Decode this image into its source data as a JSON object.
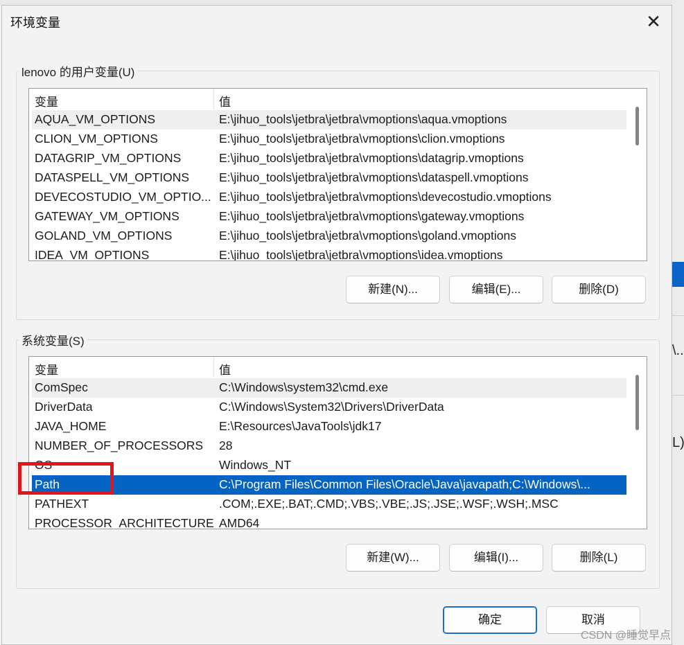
{
  "window": {
    "title": "环境变量",
    "close_label": "✕"
  },
  "user_vars": {
    "group_label": "lenovo 的用户变量(U)",
    "col_name": "变量",
    "col_value": "值",
    "rows": [
      {
        "name": "AQUA_VM_OPTIONS",
        "value": "E:\\jihuo_tools\\jetbra\\jetbra\\vmoptions\\aqua.vmoptions"
      },
      {
        "name": "CLION_VM_OPTIONS",
        "value": "E:\\jihuo_tools\\jetbra\\jetbra\\vmoptions\\clion.vmoptions"
      },
      {
        "name": "DATAGRIP_VM_OPTIONS",
        "value": "E:\\jihuo_tools\\jetbra\\jetbra\\vmoptions\\datagrip.vmoptions"
      },
      {
        "name": "DATASPELL_VM_OPTIONS",
        "value": "E:\\jihuo_tools\\jetbra\\jetbra\\vmoptions\\dataspell.vmoptions"
      },
      {
        "name": "DEVECOSTUDIO_VM_OPTIO...",
        "value": "E:\\jihuo_tools\\jetbra\\jetbra\\vmoptions\\devecostudio.vmoptions"
      },
      {
        "name": "GATEWAY_VM_OPTIONS",
        "value": "E:\\jihuo_tools\\jetbra\\jetbra\\vmoptions\\gateway.vmoptions"
      },
      {
        "name": "GOLAND_VM_OPTIONS",
        "value": "E:\\jihuo_tools\\jetbra\\jetbra\\vmoptions\\goland.vmoptions"
      },
      {
        "name": "IDEA_VM_OPTIONS",
        "value": "E:\\jihuo_tools\\jetbra\\jetbra\\vmoptions\\idea.vmoptions"
      }
    ],
    "buttons": {
      "new": "新建(N)...",
      "edit": "编辑(E)...",
      "delete": "删除(D)"
    }
  },
  "system_vars": {
    "group_label": "系统变量(S)",
    "col_name": "变量",
    "col_value": "值",
    "rows": [
      {
        "name": "ComSpec",
        "value": "C:\\Windows\\system32\\cmd.exe"
      },
      {
        "name": "DriverData",
        "value": "C:\\Windows\\System32\\Drivers\\DriverData"
      },
      {
        "name": "JAVA_HOME",
        "value": "E:\\Resources\\JavaTools\\jdk17"
      },
      {
        "name": "NUMBER_OF_PROCESSORS",
        "value": "28"
      },
      {
        "name": "OS",
        "value": "Windows_NT"
      },
      {
        "name": "Path",
        "value": "C:\\Program Files\\Common Files\\Oracle\\Java\\javapath;C:\\Windows\\..."
      },
      {
        "name": "PATHEXT",
        "value": ".COM;.EXE;.BAT;.CMD;.VBS;.VBE;.JS;.JSE;.WSF;.WSH;.MSC"
      },
      {
        "name": "PROCESSOR_ARCHITECTURE",
        "value": "AMD64"
      }
    ],
    "selected_row": "Path",
    "buttons": {
      "new": "新建(W)...",
      "edit": "编辑(I)...",
      "delete": "删除(L)"
    }
  },
  "footer": {
    "ok": "确定",
    "cancel": "取消"
  },
  "background": {
    "fragment_1": "\\..",
    "fragment_2": "L)"
  },
  "watermark": "CSDN @睡觉早点",
  "colors": {
    "selection": "#0563c1",
    "highlight_box": "#e4141c",
    "primary_border": "#1c6ec4"
  }
}
